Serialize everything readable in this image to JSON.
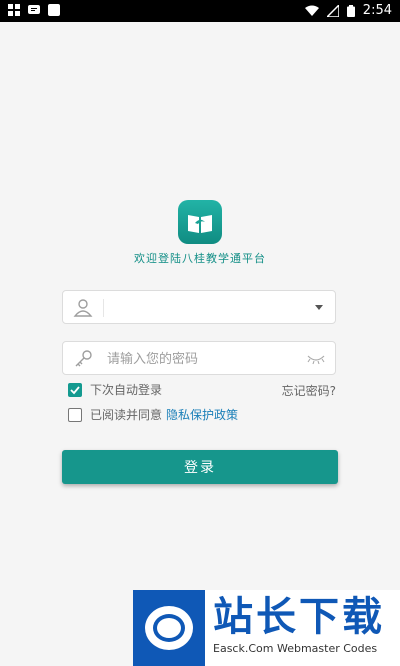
{
  "status_bar": {
    "time": "2:54",
    "icons": [
      "app-notification-icon",
      "message-icon",
      "square-icon",
      "wifi-icon",
      "signal-icon",
      "battery-icon"
    ]
  },
  "app": {
    "welcome_text": "欢迎登陆八桂教学通平台"
  },
  "form": {
    "username_value": "",
    "password_placeholder": "请输入您的密码",
    "remember_label": "下次自动登录",
    "remember_checked": true,
    "forgot_label": "忘记密码?",
    "agree_label": "已阅读并同意",
    "privacy_link": "隐私保护政策",
    "agree_checked": false,
    "login_label": "登录"
  },
  "watermark": {
    "title": "站长下载",
    "subtitle": "Easck.Com Webmaster Codes"
  },
  "colors": {
    "accent": "#16968c",
    "link": "#1a7fb8",
    "watermark": "#0f58b6"
  }
}
